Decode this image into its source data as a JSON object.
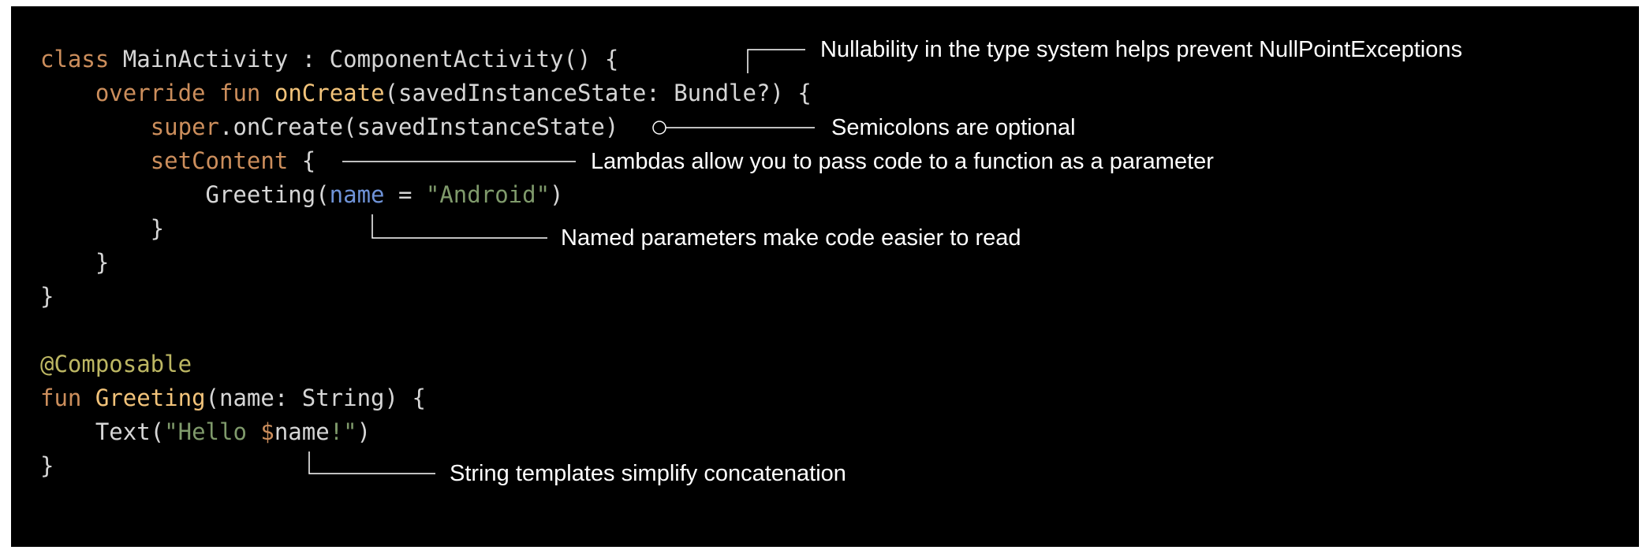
{
  "code": {
    "line1": {
      "kw_class": "class",
      "rest": " MainActivity : ComponentActivity() {"
    },
    "line2": {
      "indent": "    ",
      "kw_override": "override",
      "sp1": " ",
      "kw_fun": "fun",
      "sp2": " ",
      "fn_name": "onCreate",
      "rest": "(savedInstanceState: Bundle?) {"
    },
    "line3": {
      "indent": "        ",
      "kw_super": "super",
      "rest": ".onCreate(savedInstanceState)"
    },
    "line4": {
      "indent": "        ",
      "fn_setcontent": "setContent",
      "rest": " {"
    },
    "line5": {
      "indent": "            ",
      "call": "Greeting(",
      "param": "name",
      "eq": " = ",
      "str": "\"Android\"",
      "close": ")"
    },
    "line6": {
      "text": "        }"
    },
    "line7": {
      "text": "    }"
    },
    "line8": {
      "text": "}"
    },
    "line10": {
      "annotation": "@Composable"
    },
    "line11": {
      "kw_fun": "fun",
      "sp": " ",
      "fn_name": "Greeting",
      "rest": "(name: String) {"
    },
    "line12": {
      "indent": "    ",
      "call": "Text(",
      "str_open": "\"Hello ",
      "dollar": "$",
      "var": "name",
      "str_close": "!\"",
      "close": ")"
    },
    "line13": {
      "text": "}"
    }
  },
  "annotations": {
    "nullability": "Nullability in the type system helps prevent NullPointExceptions",
    "semicolons": "Semicolons are optional",
    "lambdas": "Lambdas allow you to pass code to a function as a parameter",
    "named_params": "Named parameters make code easier to read",
    "string_templates": "String templates simplify concatenation"
  },
  "colors": {
    "background": "#000000",
    "keyword": "#cc8e5c",
    "function": "#f2c37a",
    "string": "#7f9a6b",
    "named_param": "#6f93d8",
    "annotation": "#bdb763",
    "plain": "#d6d6d6",
    "note_text": "#ffffff"
  }
}
